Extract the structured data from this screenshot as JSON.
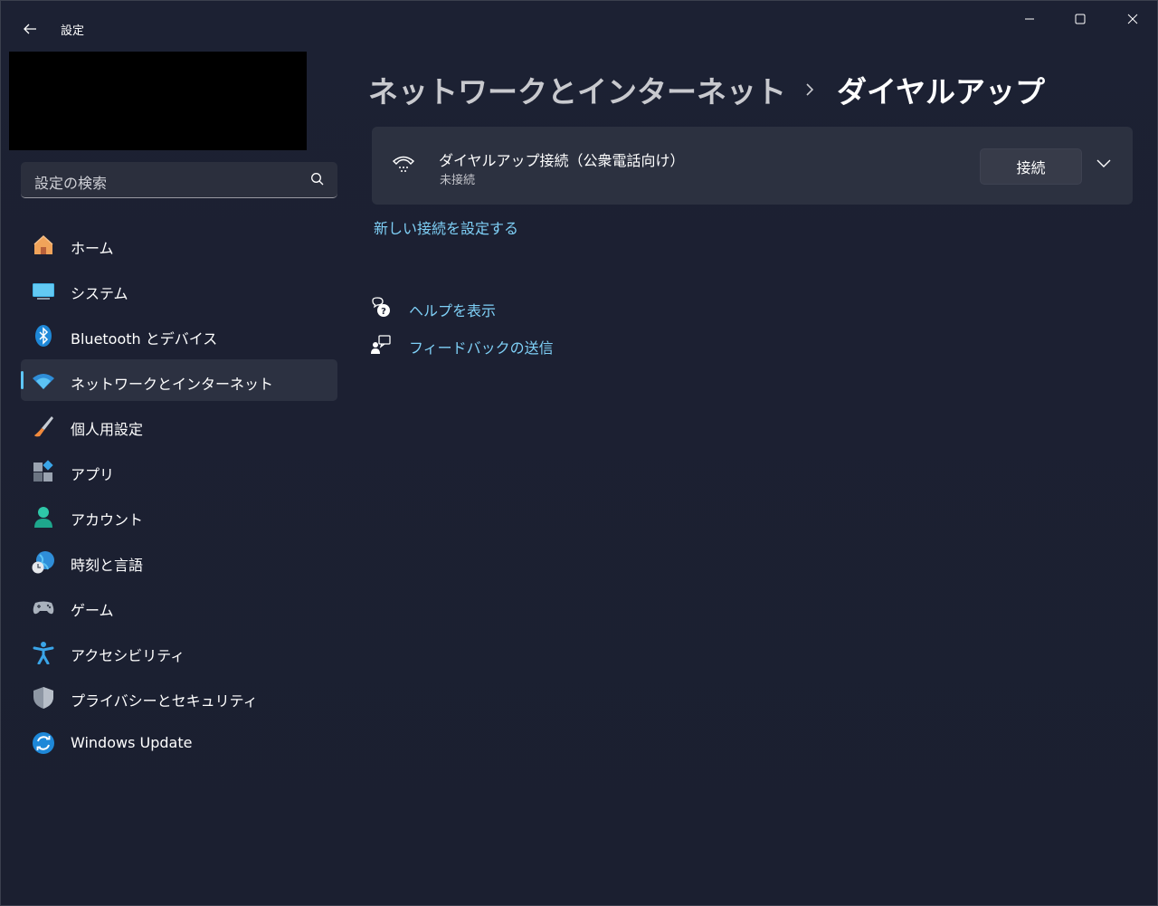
{
  "window": {
    "title": "設定",
    "controls": {
      "minimize": "minimize-icon",
      "maximize": "maximize-icon",
      "close": "close-icon"
    }
  },
  "search": {
    "placeholder": "設定の検索"
  },
  "sidebar": {
    "items": [
      {
        "label": "ホーム",
        "icon": "home-icon"
      },
      {
        "label": "システム",
        "icon": "system-icon"
      },
      {
        "label": "Bluetooth とデバイス",
        "icon": "bluetooth-icon"
      },
      {
        "label": "ネットワークとインターネット",
        "icon": "wifi-icon",
        "active": true
      },
      {
        "label": "個人用設定",
        "icon": "brush-icon"
      },
      {
        "label": "アプリ",
        "icon": "apps-icon"
      },
      {
        "label": "アカウント",
        "icon": "account-icon"
      },
      {
        "label": "時刻と言語",
        "icon": "globe-clock-icon"
      },
      {
        "label": "ゲーム",
        "icon": "gamepad-icon"
      },
      {
        "label": "アクセシビリティ",
        "icon": "accessibility-icon"
      },
      {
        "label": "プライバシーとセキュリティ",
        "icon": "shield-icon"
      },
      {
        "label": "Windows Update",
        "icon": "update-icon"
      }
    ]
  },
  "breadcrumb": {
    "parent": "ネットワークとインターネット",
    "current": "ダイヤルアップ"
  },
  "connection": {
    "title": "ダイヤルアップ接続（公衆電話向け）",
    "status": "未接続",
    "button": "接続"
  },
  "links": {
    "setup": "新しい接続を設定する",
    "help": "ヘルプを表示",
    "feedback": "フィードバックの送信"
  },
  "colors": {
    "accent": "#5ec6f5",
    "link": "#7fd0f7",
    "background": "#1b2031",
    "card": "#2c3140"
  }
}
